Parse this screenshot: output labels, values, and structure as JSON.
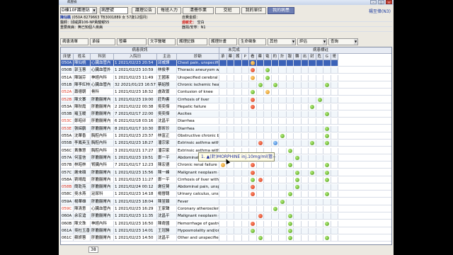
{
  "window": {
    "title": "病歷檢"
  },
  "toolbar": {
    "ward_combo": "D棟10F護理站",
    "search_placeholder": "病歷號",
    "buttons": [
      "護理公告",
      "每班人力",
      "清冊作業",
      "交班",
      "我的單位",
      "我的病患"
    ],
    "active_button": "我的病患",
    "user": "楊至偉(N3)"
  },
  "patient": {
    "name_label": "陳仙桃",
    "ids": "(050A 8279663 TB3001889 女 57歲12個月)",
    "doctor": "醫師：邱威譯106-NP黃龍郁55",
    "history": "重要疾病：無已知個人疾病",
    "self_pay": "自費金額：",
    "allergy_label": "過敏史：",
    "allergy_value": "空白",
    "organ": "器捐/安寧：N1"
  },
  "filters": [
    "病患清單",
    "承接",
    "發藥",
    "文字醫囑",
    "護理記錄",
    "護理計畫",
    "生命徵象",
    "其他",
    "評估",
    "查詢"
  ],
  "grid": {
    "group_headers": [
      "病患資訊",
      "未完成",
      "病患標註"
    ],
    "columns": [
      "床號",
      "姓名",
      "科別",
      "入院日",
      "主治",
      "診斷"
    ],
    "flag_headers": [
      "承",
      "藥",
      "護",
      "P",
      "看",
      "藥",
      "電",
      "約",
      "計",
      "報",
      "轉",
      "出",
      "封",
      "危",
      "G",
      "哥"
    ],
    "rows": [
      {
        "bed": "050A",
        "name": "陳仙桃",
        "dept": "心臟血管內",
        "admit": "1 2021/02/23 20:54",
        "doctor": "邱威譯",
        "dx": "Chest pain, unspecified",
        "red": true,
        "dots": [
          {
            "c": 4,
            "t": "orange"
          }
        ]
      },
      {
        "bed": "050B",
        "name": "郭玉蓉",
        "dept": "心臟血管外",
        "admit": "1 2021/02/23 10:59",
        "doctor": "林俊孝",
        "dx": "Thoracic aneurysm without",
        "red": false,
        "dots": [
          {
            "c": 4,
            "t": "red"
          },
          {
            "c": 6,
            "t": "green"
          }
        ]
      },
      {
        "bed": "051A",
        "name": "陳瑞芬",
        "dept": "神經內科",
        "admit": "1 2021/02/23 11:49",
        "doctor": "王國憲",
        "dx": "Unspecified cerebral artery",
        "red": false,
        "dots": [
          {
            "c": 4,
            "t": "orange"
          },
          {
            "c": 6,
            "t": "green"
          }
        ]
      },
      {
        "bed": "051B",
        "name": "陳李紅柿",
        "dept": "心臟血管內",
        "admit": "32 2021/01/23 16:57",
        "doctor": "蔡紹殷",
        "dx": "Chronic ischemic heart dise",
        "red": false,
        "dots": [
          {
            "c": 5,
            "t": "green"
          },
          {
            "c": 7,
            "t": "green"
          },
          {
            "c": 14,
            "t": "green"
          }
        ]
      },
      {
        "bed": "052A",
        "name": "蕭德朝",
        "dept": "骨科",
        "admit": "1 2021/02/23 18:32",
        "doctor": "盧政寰",
        "dx": "Contusion of knee",
        "red": true,
        "dots": [
          {
            "c": 4,
            "t": "green"
          },
          {
            "c": 6,
            "t": "orange"
          }
        ]
      },
      {
        "bed": "052B",
        "name": "陳文賽",
        "dept": "肝膽腸胃內",
        "admit": "1 2021/02/23 19:00",
        "doctor": "莊昀書",
        "dx": "Cirrhosis of liver",
        "red": true,
        "dots": [
          {
            "c": 4,
            "t": "red"
          },
          {
            "c": 13,
            "t": "green"
          }
        ]
      },
      {
        "bed": "053A",
        "name": "陳秋霞",
        "dept": "肝膽腸胃內",
        "admit": "2 2021/02/22 00:38",
        "doctor": "吳奕傑",
        "dx": "Hepatic failure",
        "red": false,
        "dots": [
          {
            "c": 4,
            "t": "red"
          },
          {
            "c": 12,
            "t": "green"
          }
        ]
      },
      {
        "bed": "053B",
        "name": "羅玉暖",
        "dept": "肝膽腸胃內",
        "admit": "7 2021/02/17 22:00",
        "doctor": "吳奕傑",
        "dx": "Ascites",
        "red": false,
        "dots": [
          {
            "c": 14,
            "t": "green"
          }
        ]
      },
      {
        "bed": "053C",
        "name": "鄭昭卯",
        "dept": "肝膽腸胃內",
        "admit": "6 2021/02/18 03:16",
        "doctor": "沈昌平",
        "dx": "Diarrhea",
        "red": true,
        "dots": []
      },
      {
        "bed": "053E",
        "name": "張綵鶴",
        "dept": "肝膽腸胃內",
        "admit": "8 2021/02/17 10:30",
        "doctor": "鄭昕珍",
        "dx": "Diarrhea",
        "red": true,
        "dots": [
          {
            "c": 14,
            "t": "green"
          }
        ]
      },
      {
        "bed": "055A",
        "name": "沈華香",
        "dept": "胸腔內科",
        "admit": "1 2021/02/23 23:37",
        "doctor": "林富正",
        "dx": "Obstructive chronic bronchi",
        "red": false,
        "dots": [
          {
            "c": 8,
            "t": "green"
          },
          {
            "c": 14,
            "t": "green"
          }
        ]
      },
      {
        "bed": "055B",
        "name": "李鳳英玉",
        "dept": "胸腔內科",
        "admit": "1 2021/02/23 18:27",
        "doctor": "潘宗家",
        "dx": "Extrinsic asthma with acute",
        "red": false,
        "dots": [
          {
            "c": 5,
            "t": "red"
          },
          {
            "c": 7,
            "t": "blue"
          },
          {
            "c": 12,
            "t": "green"
          },
          {
            "c": 14,
            "t": "green"
          }
        ]
      },
      {
        "bed": "056C",
        "name": "黃雅慧",
        "dept": "胸腔內科",
        "admit": "3 2021/02/21 17:27",
        "doctor": "潘宗家",
        "dx": "Extrinsic asthma without m",
        "red": false,
        "dots": [
          {
            "c": 9,
            "t": "green"
          }
        ]
      },
      {
        "bed": "057A",
        "name": "何富信",
        "dept": "肝膽腸胃內",
        "admit": "1 2021/02/23 19:51",
        "doctor": "鄭一平",
        "dx": "Abdominal pain, epigastric",
        "red": false,
        "dots": [
          {
            "c": 4,
            "t": "green"
          },
          {
            "c": 10,
            "t": "green"
          }
        ]
      },
      {
        "bed": "057B",
        "name": "林昭林",
        "dept": "腎臟內科",
        "admit": "7 2021/02/17 12:23",
        "doctor": "陳宏德",
        "dx": "Chronic renal failure",
        "red": false,
        "dots": [
          {
            "c": 0,
            "t": "orange"
          },
          {
            "c": 4,
            "t": "red"
          },
          {
            "c": 9,
            "t": "green"
          },
          {
            "c": 14,
            "t": "green"
          }
        ]
      },
      {
        "bed": "057C",
        "name": "謝來碩",
        "dept": "肝膽腸胃內",
        "admit": "1 2021/02/23 15:56",
        "doctor": "陳一峰",
        "dx": "Malignant neoplasm of liver",
        "red": false,
        "dots": [
          {
            "c": 4,
            "t": "red"
          },
          {
            "c": 10,
            "t": "green"
          },
          {
            "c": 12,
            "t": "green"
          },
          {
            "c": 14,
            "t": "green"
          }
        ]
      },
      {
        "bed": "058A",
        "name": "劉晴霞",
        "dept": "肝膽腸胃內",
        "admit": "1 2021/02/23 11:27",
        "doctor": "鄭一平",
        "dx": "Cirrhosis of liver without m",
        "red": false,
        "dots": [
          {
            "c": 4,
            "t": "green"
          },
          {
            "c": 5,
            "t": "red"
          },
          {
            "c": 10,
            "t": "green"
          },
          {
            "c": 14,
            "t": "green"
          }
        ]
      },
      {
        "bed": "058B",
        "name": "簡乾苑",
        "dept": "肝膽腸胃內",
        "admit": "1 2021/02/24 00:12",
        "doctor": "謝佳賢",
        "dx": "Abdominal pain, unspecified",
        "red": true,
        "dots": [
          {
            "c": 4,
            "t": "red"
          },
          {
            "c": 10,
            "t": "green"
          }
        ]
      },
      {
        "bed": "058C",
        "name": "吳水燕",
        "dept": "泌尿科",
        "admit": "1 2021/02/23 14:18",
        "doctor": "楊晉聰",
        "dx": "Urinary calculus, unspecified",
        "red": false,
        "dots": [
          {
            "c": 4,
            "t": "red"
          },
          {
            "c": 9,
            "t": "green"
          },
          {
            "c": 14,
            "t": "green"
          }
        ]
      },
      {
        "bed": "059A",
        "name": "楊華雄",
        "dept": "肝膽腸胃內",
        "admit": "1 2021/02/23 18:04",
        "doctor": "陳昱穎",
        "dx": "Fever",
        "red": false,
        "dots": [
          {
            "c": 8,
            "t": "green"
          }
        ]
      },
      {
        "bed": "059C",
        "name": "陳清意",
        "dept": "心臟血管內",
        "admit": "1 2021/02/23 16:29",
        "doctor": "王家聲",
        "dx": "Coronary atherosclerosis of",
        "red": true,
        "dots": [
          {
            "c": 7,
            "t": "green"
          }
        ]
      },
      {
        "bed": "060A",
        "name": "余宏滄",
        "dept": "肝膽腸胃內",
        "admit": "1 2021/02/23 11:35",
        "doctor": "沈昌平",
        "dx": "Malignant neoplasm of liver",
        "red": false,
        "dots": [
          {
            "c": 5,
            "t": "red"
          },
          {
            "c": 9,
            "t": "green"
          }
        ]
      },
      {
        "bed": "060B",
        "name": "陳文珠",
        "dept": "神經內科",
        "admit": "1 2021/02/23 16:50",
        "doctor": "陳奇國",
        "dx": "Hemorrhage of gastrointest",
        "red": false,
        "dots": [
          {
            "c": 4,
            "t": "red"
          },
          {
            "c": 9,
            "t": "green"
          },
          {
            "c": 14,
            "t": "green"
          }
        ]
      },
      {
        "bed": "061A",
        "name": "吳杜玉香",
        "dept": "肝膽腸胃內",
        "admit": "1 2021/02/23 14:01",
        "doctor": "王冠勝",
        "dx": "Hyposmolality and/or hypor",
        "red": false,
        "dots": [
          {
            "c": 4,
            "t": "green"
          },
          {
            "c": 9,
            "t": "green"
          }
        ]
      },
      {
        "bed": "061C",
        "name": "蘇妍蓉",
        "dept": "肝膽腸胃內",
        "admit": "1 2021/02/23 14:50",
        "doctor": "沈昌平",
        "dx": "Other and unspecified noni",
        "red": false,
        "dots": [
          {
            "c": 5,
            "t": "green"
          },
          {
            "c": 9,
            "t": "green"
          },
          {
            "c": 14,
            "t": "green"
          }
        ]
      }
    ]
  },
  "tooltip": "1. ▲(針)MORPHINE inj.10mg/ml(管--",
  "footer": {
    "count": "38"
  },
  "colors": {
    "selected_row": "#3b62b8",
    "red_bed": "#e0301c",
    "header_bg": "#e8ecf4"
  }
}
